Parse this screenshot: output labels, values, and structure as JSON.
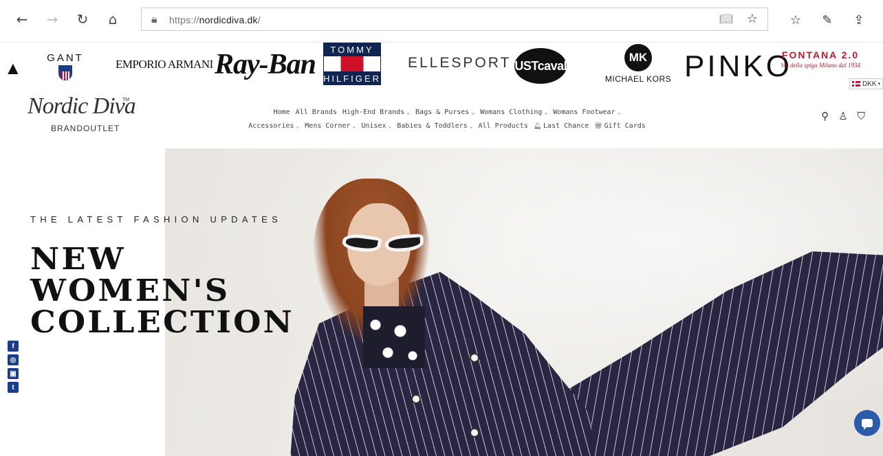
{
  "browser": {
    "url_prefix": "https://",
    "url_domain": "nordicdiva.dk",
    "url_suffix": "/"
  },
  "brands": {
    "partial": "▲",
    "gant": "GANT",
    "armani": "EMPORIO ARMANI",
    "rayban": "Ray-Ban",
    "tommy_top": "TOMMY",
    "tommy_bottom": "HILFIGER",
    "elle": "ELLESPORT",
    "cavalli": "JUSTcavalli",
    "mk_badge": "MK",
    "mk_name": "MICHAEL KORS",
    "pinko": "PINKO",
    "fontana": "FONTANA 2.0",
    "fontana_sub": "Via della spiga Milano dal 1934"
  },
  "currency": "DKK",
  "logo": {
    "script": "Nordic Diva",
    "tm": "TM",
    "sub": "BRANDOUTLET"
  },
  "nav": {
    "row1": [
      {
        "label": "Home",
        "dropdown": false
      },
      {
        "label": "All Brands",
        "dropdown": false
      },
      {
        "label": "High-End Brands",
        "dropdown": true
      },
      {
        "label": "Bags & Purses",
        "dropdown": true
      },
      {
        "label": "Womans Clothing",
        "dropdown": true
      },
      {
        "label": "Womans Footwear",
        "dropdown": true
      }
    ],
    "row2": [
      {
        "label": "Accessories",
        "dropdown": true
      },
      {
        "label": "Mens Corner",
        "dropdown": true
      },
      {
        "label": "Unisex",
        "dropdown": true
      },
      {
        "label": "Babies & Toddlers",
        "dropdown": true
      },
      {
        "label": "All Products",
        "dropdown": false
      },
      {
        "label": "Last Chance",
        "dropdown": false,
        "icon": "bell-icon"
      },
      {
        "label": "Gift Cards",
        "dropdown": false,
        "icon": "gift-icon"
      }
    ]
  },
  "hero": {
    "kicker": "THE LATEST FASHION UPDATES",
    "headline_1": "NEW",
    "headline_2": "WOMEN'S",
    "headline_3": "COLLECTION"
  },
  "social": [
    "f",
    "◎",
    "▣",
    "t"
  ],
  "colors": {
    "social": "#1c3e8a",
    "chat": "#2b5aa8",
    "fontana": "#c0172d"
  }
}
